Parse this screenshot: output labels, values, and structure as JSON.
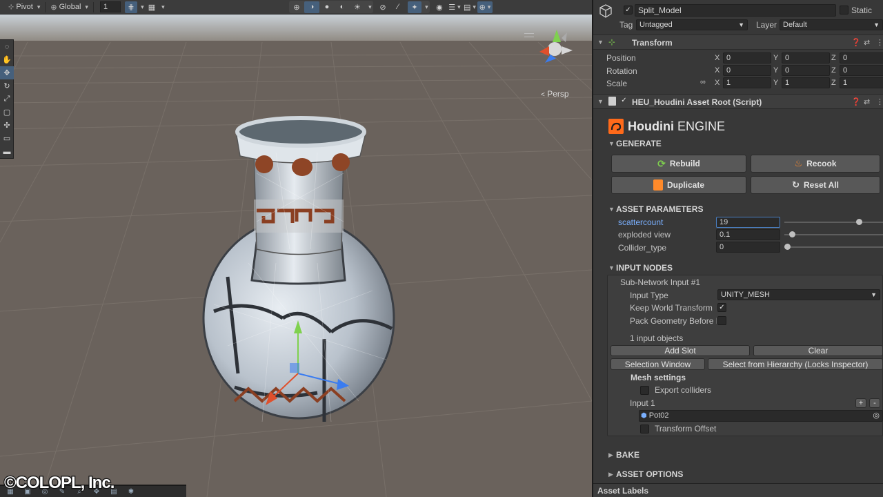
{
  "scene_toolbar": {
    "pivot_label": "Pivot",
    "global_label": "Global",
    "grid_value": "1"
  },
  "scene": {
    "camera_mode": "Persp"
  },
  "watermark": "©COLOPL, Inc.",
  "inspector": {
    "object_name": "Split_Model",
    "static_label": "Static",
    "tag_label": "Tag",
    "tag_value": "Untagged",
    "layer_label": "Layer",
    "layer_value": "Default",
    "transform": {
      "title": "Transform",
      "position_label": "Position",
      "rotation_label": "Rotation",
      "scale_label": "Scale",
      "axes": [
        "X",
        "Y",
        "Z"
      ],
      "position": [
        "0",
        "0",
        "0"
      ],
      "rotation": [
        "0",
        "0",
        "0"
      ],
      "scale": [
        "1",
        "1",
        "1"
      ]
    },
    "script_component": {
      "title": "HEU_Houdini Asset Root (Script)",
      "brand": "Houdini",
      "brand_suffix": "ENGINE",
      "generate_title": "GENERATE",
      "buttons": {
        "rebuild": "Rebuild",
        "recook": "Recook",
        "duplicate": "Duplicate",
        "reset_all": "Reset All"
      },
      "asset_params_title": "ASSET PARAMETERS",
      "params": [
        {
          "label": "scattercount",
          "value": "19",
          "level": 0.78
        },
        {
          "label": "exploded view",
          "value": "0.1",
          "level": 0.05
        },
        {
          "label": "Collider_type",
          "value": "0",
          "level": 0.0
        }
      ],
      "input_nodes_title": "INPUT NODES",
      "sub_network": "Sub-Network Input #1",
      "input_type_label": "Input Type",
      "input_type_value": "UNITY_MESH",
      "keep_world_label": "Keep World Transform",
      "pack_geometry_label": "Pack Geometry Before M",
      "input_objects_count": "1 input objects",
      "add_slot": "Add Slot",
      "clear": "Clear",
      "selection_window": "Selection Window",
      "select_from_hierarchy": "Select from Hierarchy (Locks Inspector)",
      "mesh_settings": "Mesh settings",
      "export_colliders": "Export colliders",
      "input_1": "Input 1",
      "plus": "+",
      "minus": "-",
      "object_ref": "Pot02",
      "transform_offset": "Transform Offset",
      "bake_title": "BAKE",
      "asset_options_title": "ASSET OPTIONS"
    },
    "asset_labels": "Asset Labels"
  },
  "colors": {
    "accent_blue": "#46607c",
    "houdini_orange": "#ff6a1a",
    "selected_param": "#7ab0ff"
  }
}
